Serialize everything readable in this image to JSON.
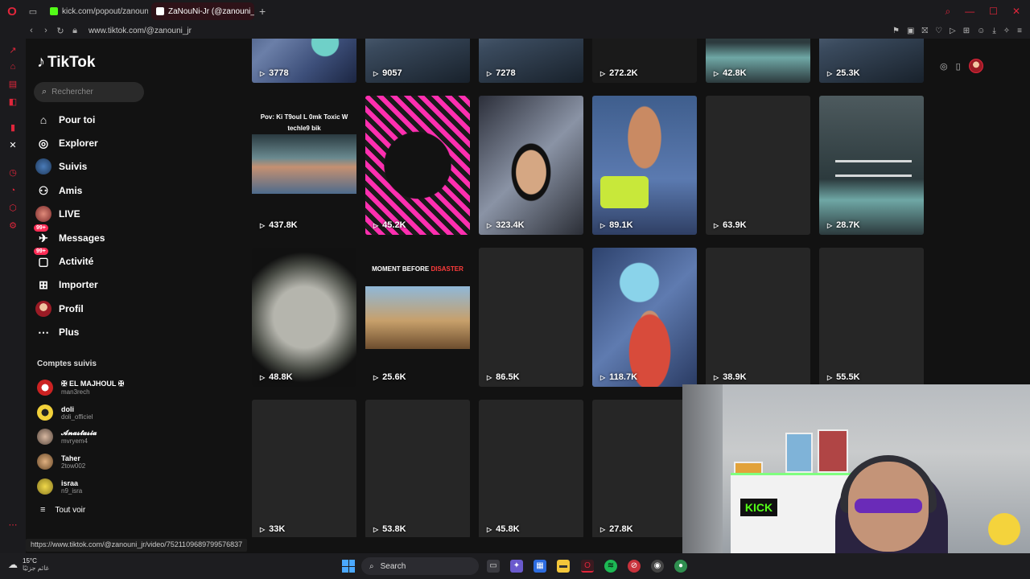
{
  "browser": {
    "tabs": [
      {
        "title": "kick.com/popout/zanouni",
        "active": false
      },
      {
        "title": "ZaNouNi-Jr (@zanouni_jr)",
        "active": true
      }
    ],
    "url": "www.tiktok.com/@zanouni_jr",
    "status_url": "https://www.tiktok.com/@zanouni_jr/video/7521109689799576837"
  },
  "sidebar": {
    "logo": "TikTok",
    "search_placeholder": "Rechercher",
    "nav": [
      {
        "label": "Pour toi",
        "icon": "home-icon"
      },
      {
        "label": "Explorer",
        "icon": "compass-icon"
      },
      {
        "label": "Suivis",
        "icon": "following-avatar"
      },
      {
        "label": "Amis",
        "icon": "friends-icon"
      },
      {
        "label": "LIVE",
        "icon": "live-avatar"
      },
      {
        "label": "Messages",
        "icon": "messages-icon",
        "badge": "99+"
      },
      {
        "label": "Activité",
        "icon": "activity-icon",
        "badge": "99+"
      },
      {
        "label": "Importer",
        "icon": "upload-icon"
      },
      {
        "label": "Profil",
        "icon": "profile-avatar"
      },
      {
        "label": "Plus",
        "icon": "more-icon"
      }
    ],
    "following_title": "Comptes suivis",
    "accounts": [
      {
        "name": "✠ EL MAJHOUL ✠",
        "handle": "man3rech"
      },
      {
        "name": "doli",
        "handle": "doli_officiel"
      },
      {
        "name": "𝓐𝓷𝓪𝓼𝓽𝓪𝓼𝓲𝓪",
        "handle": "mvryem4"
      },
      {
        "name": "Taher",
        "handle": "2tow002"
      },
      {
        "name": "israa",
        "handle": "n9_isra"
      }
    ],
    "see_all": "Tout voir"
  },
  "videos": {
    "row1": [
      "3778",
      "9057",
      "7278",
      "272.2K",
      "42.8K",
      "25.3K"
    ],
    "row2": [
      "437.8K",
      "45.2K",
      "323.4K",
      "89.1K",
      "63.9K",
      "28.7K"
    ],
    "row3": [
      "48.8K",
      "25.6K",
      "86.5K",
      "118.7K",
      "38.9K",
      "55.5K"
    ],
    "row4": [
      "33K",
      "53.8K",
      "45.8K",
      "27.8K"
    ],
    "caption_1": "Pov: Ki T9oul L 0mk Toxic W techle9 bik",
    "caption_2_a": "MOMENT BEFORE ",
    "caption_2_b": "DISASTER"
  },
  "webcam": {
    "sign": "KICK"
  },
  "taskbar": {
    "temp": "15°C",
    "weather_text": "غائم جزئيًا",
    "search": "Search"
  },
  "colors": {
    "accent": "#fe2c55",
    "opera": "#e0263b",
    "kick": "#53fc18"
  }
}
